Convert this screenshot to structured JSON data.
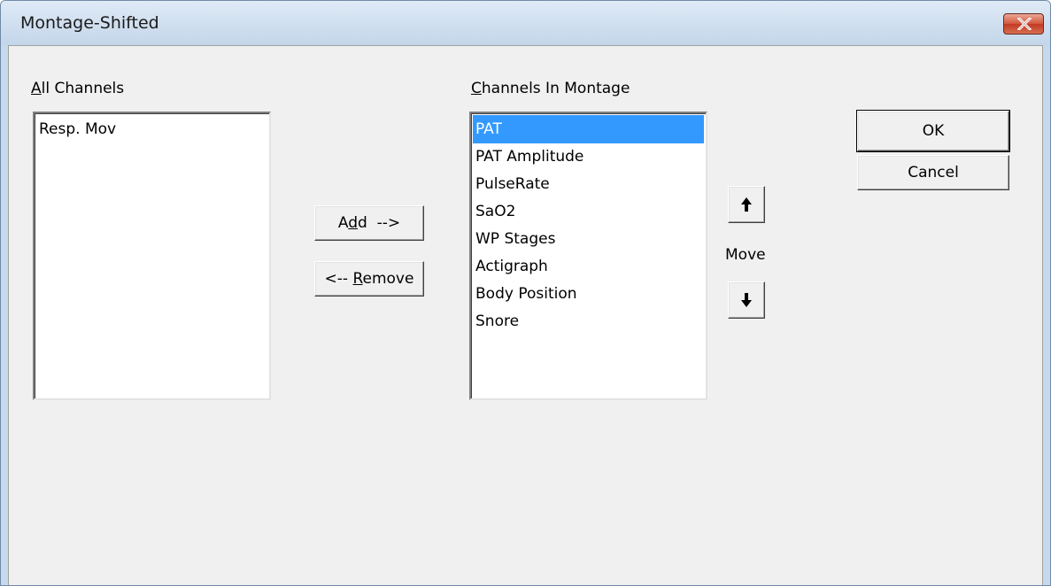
{
  "window": {
    "title": "Montage-Shifted"
  },
  "all_channels": {
    "label_prefix": "",
    "label_accel": "A",
    "label_rest": "ll Channels",
    "items": [
      "Resp. Mov"
    ]
  },
  "montage_channels": {
    "label_accel": "C",
    "label_rest": "hannels In Montage",
    "selected_index": 0,
    "items": [
      "PAT",
      "PAT Amplitude",
      "PulseRate",
      "SaO2",
      "WP Stages",
      "Actigraph",
      "Body Position",
      "Snore"
    ]
  },
  "buttons": {
    "add_pre": "A",
    "add_accel": "d",
    "add_post": "d  -->",
    "remove_pre": "<-- ",
    "remove_accel": "R",
    "remove_post": "emove",
    "ok": "OK",
    "cancel": "Cancel",
    "move_label": "Move"
  },
  "icons": {
    "close": "close-x-icon",
    "move_up": "arrow-up-icon",
    "move_down": "arrow-down-icon"
  },
  "colors": {
    "selection": "#3399ff",
    "close_button": "#c9452c"
  }
}
